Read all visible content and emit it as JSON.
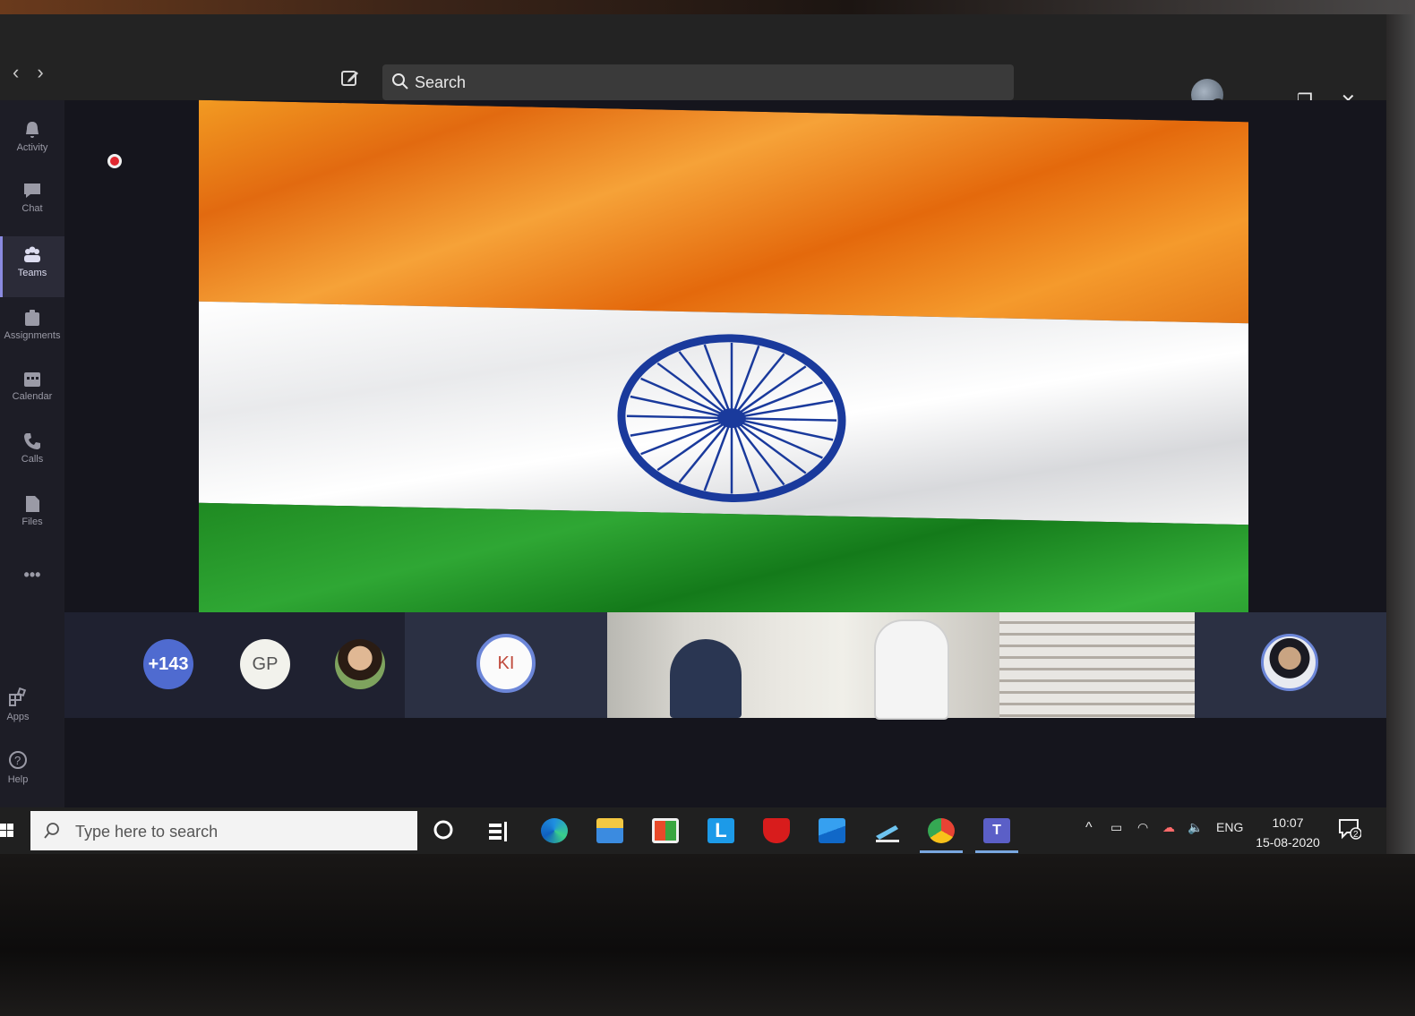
{
  "titlebar": {
    "search_placeholder": "Search"
  },
  "rail": {
    "items": [
      {
        "label": "Activity",
        "icon": "bell-icon"
      },
      {
        "label": "Chat",
        "icon": "chat-icon"
      },
      {
        "label": "Teams",
        "icon": "teams-icon"
      },
      {
        "label": "Assignments",
        "icon": "assignments-icon"
      },
      {
        "label": "Calendar",
        "icon": "calendar-icon"
      },
      {
        "label": "Calls",
        "icon": "phone-icon"
      },
      {
        "label": "Files",
        "icon": "file-icon"
      }
    ],
    "more": "•••",
    "apps_label": "Apps",
    "help_label": "Help"
  },
  "participants": {
    "overflow_count": "+143",
    "gp_initials": "GP",
    "ki_initials": "KI"
  },
  "taskbar": {
    "search_placeholder": "Type here to search",
    "language": "ENG",
    "time": "10:07",
    "date": "15-08-2020",
    "notification_count": "2"
  },
  "colors": {
    "saffron": "#f29a22",
    "white": "#ffffff",
    "green": "#1f8a22",
    "chakra_blue": "#1a3a9c",
    "recording_red": "#e02830",
    "avatar_blue": "#4f6bd0"
  }
}
